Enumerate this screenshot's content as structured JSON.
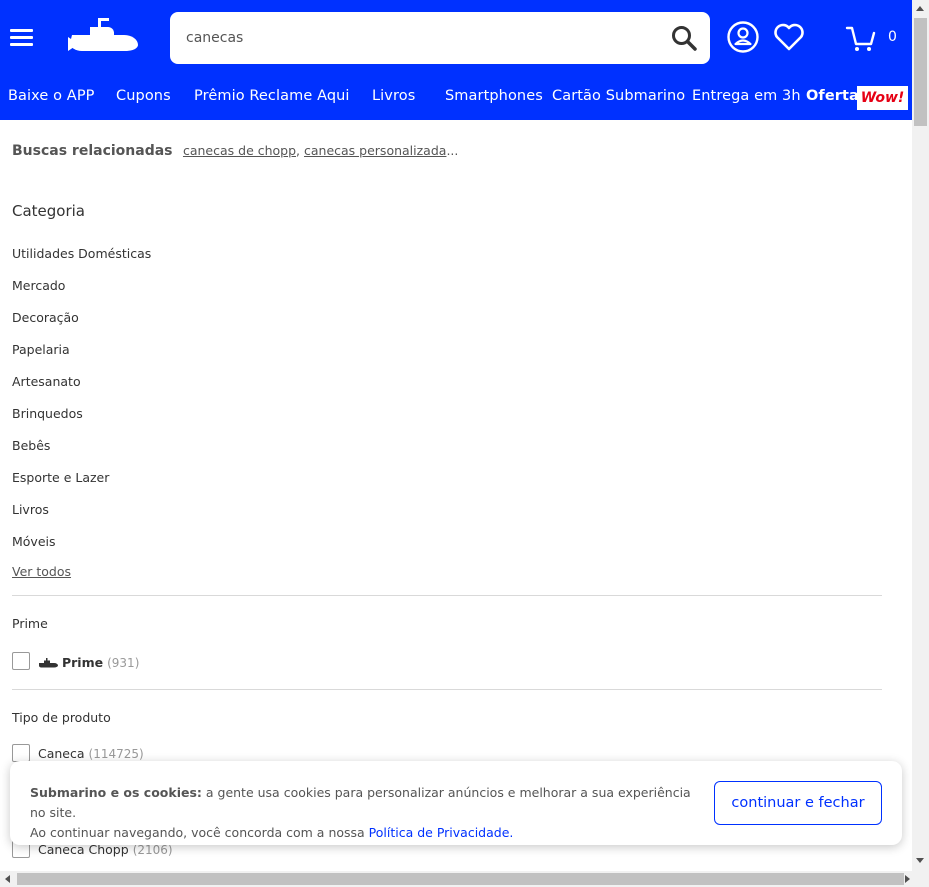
{
  "header": {
    "search_value": "canecas",
    "cart_count": "0",
    "nav": [
      "Baixe o APP",
      "Cupons",
      "Prêmio Reclame Aqui",
      "Livros",
      "Smartphones",
      "Cartão Submarino",
      "Entrega em 3h",
      "Oferta"
    ],
    "wow_badge": "Wow!"
  },
  "related": {
    "title": "Buscas relacionadas",
    "links": [
      "canecas de chopp",
      "canecas personalizada"
    ],
    "ellipsis": "..."
  },
  "category": {
    "title": "Categoria",
    "items": [
      "Utilidades Domésticas",
      "Mercado",
      "Decoração",
      "Papelaria",
      "Artesanato",
      "Brinquedos",
      "Bebês",
      "Esporte e Lazer",
      "Livros",
      "Móveis"
    ],
    "see_all": "Ver todos"
  },
  "prime": {
    "title": "Prime",
    "option_label": "Prime",
    "option_count": "(931)"
  },
  "product_type": {
    "title": "Tipo de produto",
    "options": [
      {
        "label": "Caneca",
        "count": "(114725)"
      },
      {
        "label": "Caneca Chopp",
        "count": "(2106)"
      }
    ]
  },
  "cookie": {
    "bold": "Submarino e os cookies:",
    "text1": " a gente usa cookies para personalizar anúncios e melhorar a sua experiência no site.",
    "text2": "Ao continuar navegando, você concorda com a nossa ",
    "link": "Política de Privacidade.",
    "button": "continuar e fechar"
  },
  "colors": {
    "brand_blue": "#0031ff",
    "wow_red": "#e60014"
  },
  "icons": [
    "menu-icon",
    "submarine-logo",
    "search-icon",
    "user-icon",
    "heart-icon",
    "cart-icon",
    "submarine-prime-icon"
  ]
}
